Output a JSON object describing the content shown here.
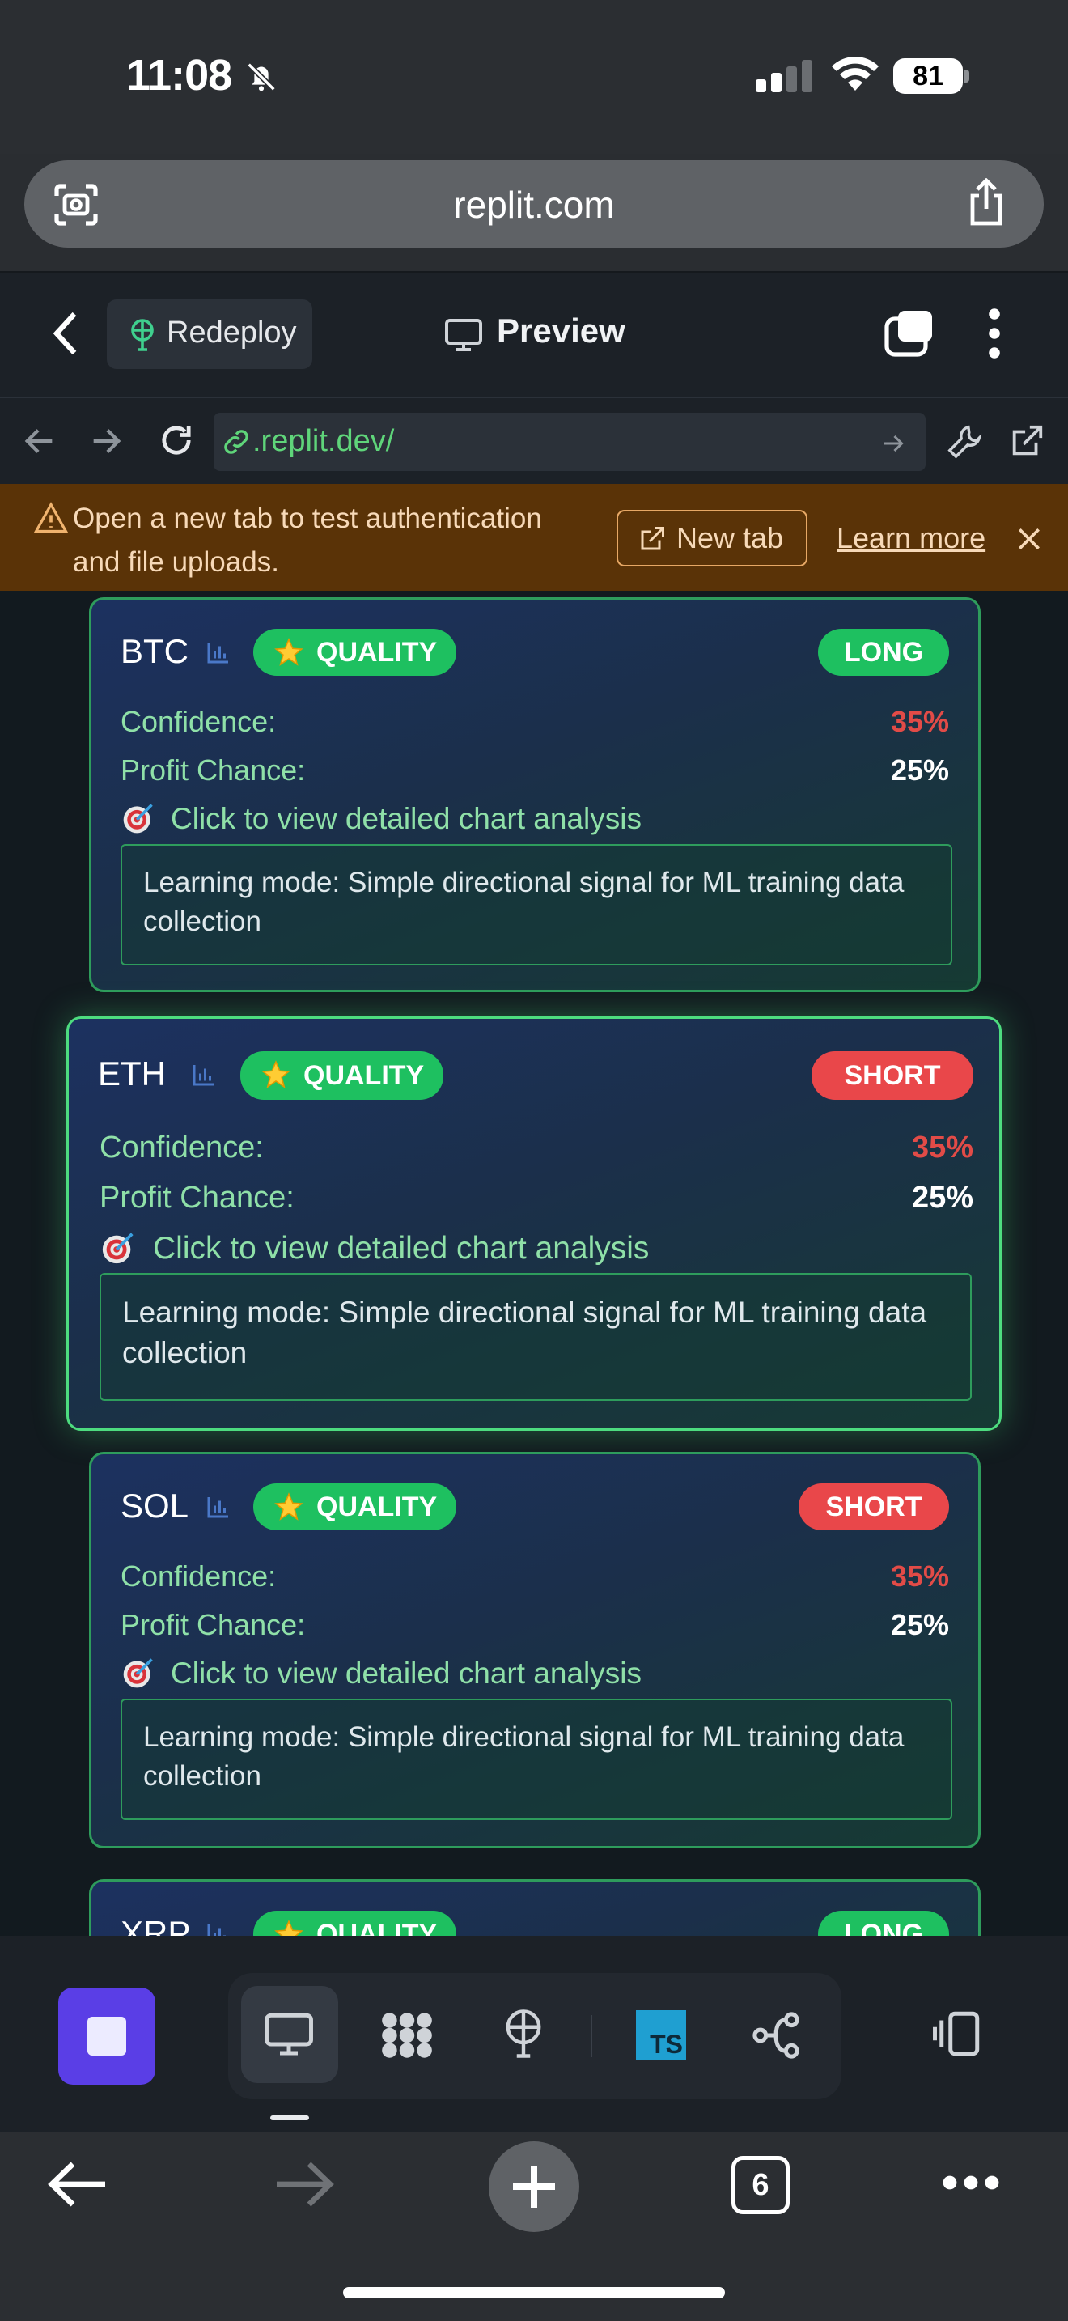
{
  "status": {
    "time": "11:08",
    "battery": "81"
  },
  "safari": {
    "address": "replit.com",
    "tab_count": "6"
  },
  "replit_header": {
    "redeploy_label": "Redeploy",
    "preview_label": "Preview"
  },
  "browser": {
    "url": ".replit.dev/"
  },
  "banner": {
    "message": "Open a new tab to test authentication and file uploads.",
    "new_tab_label": "New tab",
    "learn_more_label": "Learn more"
  },
  "cards": [
    {
      "symbol": "BTC",
      "quality": "QUALITY",
      "direction": "LONG",
      "confidence_label": "Confidence:",
      "confidence": "35%",
      "profit_label": "Profit Chance:",
      "profit": "25%",
      "cta": "Click to view detailed chart analysis",
      "note": "Learning mode: Simple directional signal for ML training data collection"
    },
    {
      "symbol": "ETH",
      "quality": "QUALITY",
      "direction": "SHORT",
      "confidence_label": "Confidence:",
      "confidence": "35%",
      "profit_label": "Profit Chance:",
      "profit": "25%",
      "cta": "Click to view detailed chart analysis",
      "note": "Learning mode: Simple directional signal for ML training data collection"
    },
    {
      "symbol": "SOL",
      "quality": "QUALITY",
      "direction": "SHORT",
      "confidence_label": "Confidence:",
      "confidence": "35%",
      "profit_label": "Profit Chance:",
      "profit": "25%",
      "cta": "Click to view detailed chart analysis",
      "note": "Learning mode: Simple directional signal for ML training data collection"
    },
    {
      "symbol": "XRP",
      "quality": "QUALITY",
      "direction": "LONG"
    }
  ],
  "toolbar": {
    "ts_badge": "TS"
  },
  "colors": {
    "accent_green": "#1ec060",
    "short_red": "#e9474a",
    "confidence_red": "#e24b47",
    "label_green": "#8fe0a8",
    "stop_purple": "#5a3ee6",
    "banner_bg": "#5a3307"
  }
}
